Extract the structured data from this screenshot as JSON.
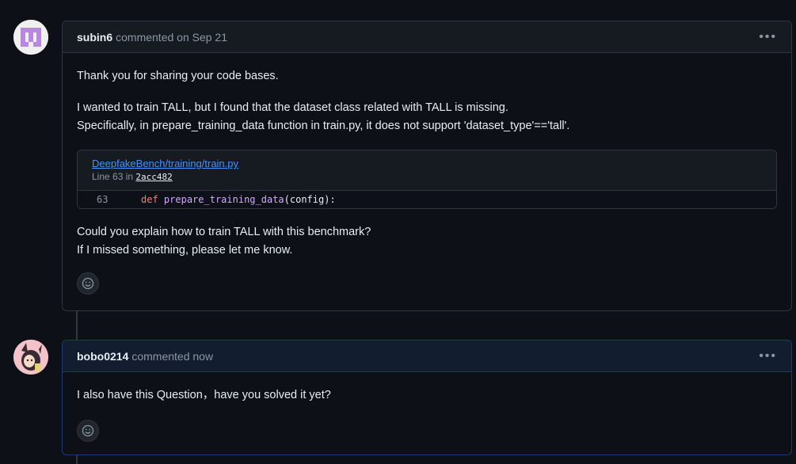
{
  "comments": [
    {
      "author": "subin6",
      "meta": "commented on Sep 21",
      "paragraphs": [
        "Thank you for sharing your code bases.",
        "I wanted to train TALL, but I found that the dataset class related with TALL is missing.",
        "Specifically, in prepare_training_data function in train.py, it does not support 'dataset_type'=='tall'."
      ],
      "snippet": {
        "path": "DeepfakeBench/training/train.py",
        "line_prefix": "Line 63 in",
        "sha": "2acc482",
        "line_number": "63",
        "code_keyword": "def",
        "code_function": "prepare_training_data",
        "code_rest": "(config):"
      },
      "closing": [
        "Could you explain how to train TALL with this benchmark?",
        "If I missed something, please let me know."
      ],
      "avatar_color": "#b889e0"
    },
    {
      "author": "bobo0214",
      "meta": "commented now",
      "paragraphs": [
        "I also have this Question，have you solved it yet?"
      ],
      "avatar_color": "#e8a0a8"
    }
  ],
  "icons": {
    "menu": "kebab-horizontal-icon",
    "reaction": "smiley-icon"
  },
  "menu_glyph": "•••"
}
